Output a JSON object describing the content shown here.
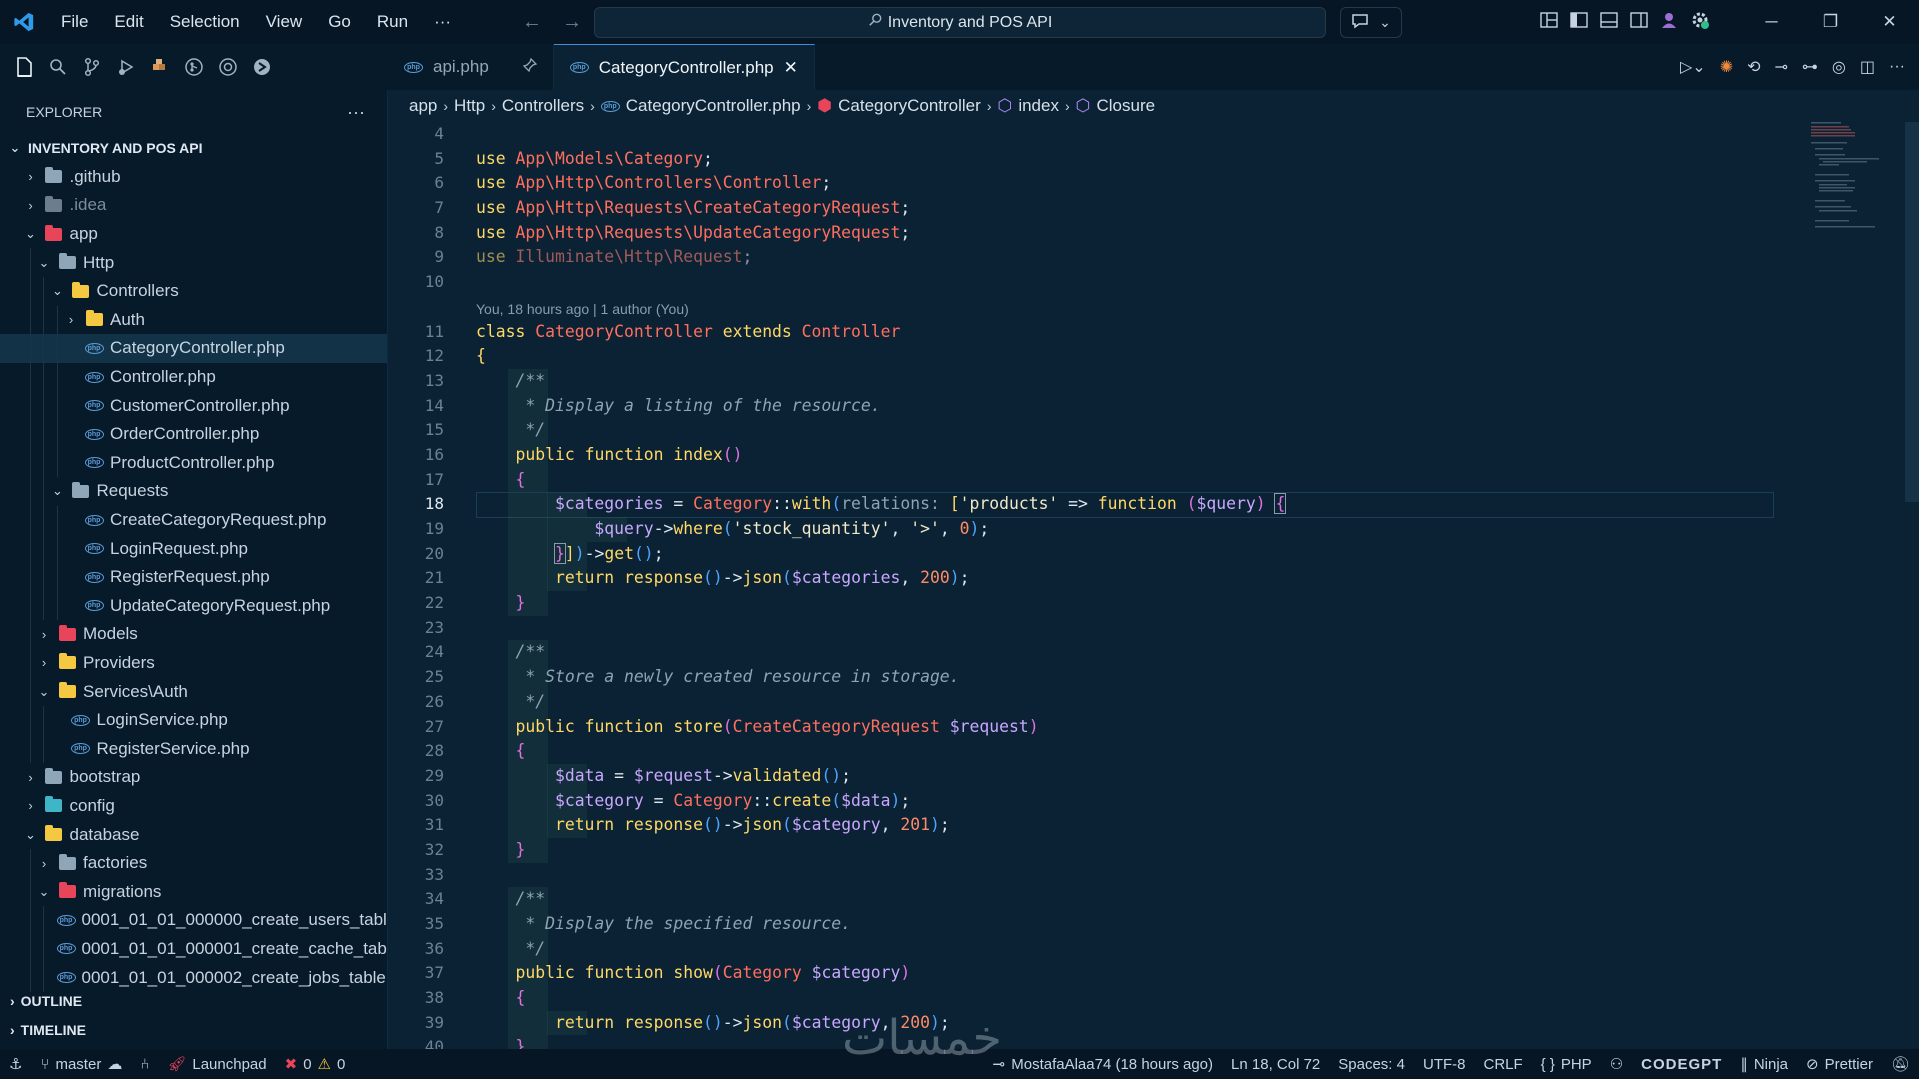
{
  "window": {
    "title": "Inventory and POS API"
  },
  "menu": [
    "File",
    "Edit",
    "Selection",
    "View",
    "Go",
    "Run",
    "···"
  ],
  "sidebar": {
    "header": "EXPLORER",
    "more": "···",
    "project": "INVENTORY AND POS API",
    "items": [
      {
        "label": ".github",
        "depth": 1,
        "kind": "folder",
        "color": "#8fa6b8",
        "open": false,
        "chev": true
      },
      {
        "label": ".idea",
        "depth": 1,
        "kind": "folder",
        "color": "#6c7e8c",
        "open": false,
        "chev": true,
        "dim": true
      },
      {
        "label": "app",
        "depth": 1,
        "kind": "folder",
        "color": "#e8455a",
        "open": true,
        "chev": true
      },
      {
        "label": "Http",
        "depth": 2,
        "kind": "folder",
        "color": "#8fa6b8",
        "open": true,
        "chev": true
      },
      {
        "label": "Controllers",
        "depth": 3,
        "kind": "folder",
        "color": "#f5c842",
        "open": true,
        "chev": true
      },
      {
        "label": "Auth",
        "depth": 4,
        "kind": "folder",
        "color": "#f5c842",
        "open": false,
        "chev": true
      },
      {
        "label": "CategoryController.php",
        "depth": 4,
        "kind": "php",
        "selected": true
      },
      {
        "label": "Controller.php",
        "depth": 4,
        "kind": "php"
      },
      {
        "label": "CustomerController.php",
        "depth": 4,
        "kind": "php"
      },
      {
        "label": "OrderController.php",
        "depth": 4,
        "kind": "php"
      },
      {
        "label": "ProductController.php",
        "depth": 4,
        "kind": "php"
      },
      {
        "label": "Requests",
        "depth": 3,
        "kind": "folder",
        "color": "#8fa6b8",
        "open": true,
        "chev": true
      },
      {
        "label": "CreateCategoryRequest.php",
        "depth": 4,
        "kind": "php"
      },
      {
        "label": "LoginRequest.php",
        "depth": 4,
        "kind": "php"
      },
      {
        "label": "RegisterRequest.php",
        "depth": 4,
        "kind": "php"
      },
      {
        "label": "UpdateCategoryRequest.php",
        "depth": 4,
        "kind": "php"
      },
      {
        "label": "Models",
        "depth": 2,
        "kind": "folder",
        "color": "#e8455a",
        "open": false,
        "chev": true
      },
      {
        "label": "Providers",
        "depth": 2,
        "kind": "folder",
        "color": "#f5c842",
        "open": false,
        "chev": true
      },
      {
        "label": "Services\\Auth",
        "depth": 2,
        "kind": "folder",
        "color": "#f5c842",
        "open": true,
        "chev": true
      },
      {
        "label": "LoginService.php",
        "depth": 3,
        "kind": "php"
      },
      {
        "label": "RegisterService.php",
        "depth": 3,
        "kind": "php"
      },
      {
        "label": "bootstrap",
        "depth": 1,
        "kind": "folder",
        "color": "#8fa6b8",
        "open": false,
        "chev": true
      },
      {
        "label": "config",
        "depth": 1,
        "kind": "folder",
        "color": "#3fb6c8",
        "open": false,
        "chev": true
      },
      {
        "label": "database",
        "depth": 1,
        "kind": "folder",
        "color": "#f5c842",
        "open": true,
        "chev": true
      },
      {
        "label": "factories",
        "depth": 2,
        "kind": "folder",
        "color": "#8fa6b8",
        "open": false,
        "chev": true
      },
      {
        "label": "migrations",
        "depth": 2,
        "kind": "folder",
        "color": "#e8455a",
        "open": true,
        "chev": true
      },
      {
        "label": "0001_01_01_000000_create_users_tabl...",
        "depth": 3,
        "kind": "php"
      },
      {
        "label": "0001_01_01_000001_create_cache_tabl...",
        "depth": 3,
        "kind": "php"
      },
      {
        "label": "0001_01_01_000002_create_jobs_table...",
        "depth": 3,
        "kind": "php"
      }
    ],
    "outline": "OUTLINE",
    "timeline": "TIMELINE"
  },
  "tabs": [
    {
      "label": "api.php",
      "active": false
    },
    {
      "label": "CategoryController.php",
      "active": true
    }
  ],
  "breadcrumb": [
    "app",
    "Http",
    "Controllers",
    "CategoryController.php",
    "CategoryController",
    "index",
    "Closure"
  ],
  "editor": {
    "lens": "You, 18 hours ago | 1 author (You)",
    "lines": [
      {
        "n": "4",
        "html": ""
      },
      {
        "n": "5",
        "html": "<span class=\"k\">use</span> <span class=\"ns\">App\\Models\\Category</span>;"
      },
      {
        "n": "6",
        "html": "<span class=\"k\">use</span> <span class=\"ns\">App\\Http\\Controllers\\Controller</span>;"
      },
      {
        "n": "7",
        "html": "<span class=\"k\">use</span> <span class=\"ns\">App\\Http\\Requests\\CreateCategoryRequest</span>;"
      },
      {
        "n": "8",
        "html": "<span class=\"k\">use</span> <span class=\"ns\">App\\Http\\Requests\\UpdateCategoryRequest</span>;"
      },
      {
        "n": "9",
        "html": "<span class=\"k\" style=\"opacity:.6\">use</span> <span class=\"dim\">Illuminate\\Http\\Request</span><span style=\"opacity:.6\">;</span>"
      },
      {
        "n": "10",
        "html": ""
      },
      {
        "lens": true
      },
      {
        "n": "11",
        "html": "<span class=\"k\">class</span> <span class=\"cls\">CategoryController</span> <span class=\"k\">extends</span> <span class=\"cls\">Controller</span>"
      },
      {
        "n": "12",
        "html": "<span class=\"br1\">{</span>"
      },
      {
        "n": "13",
        "guides": 1,
        "html": "    <span class=\"cm\">/**</span>"
      },
      {
        "n": "14",
        "guides": 1,
        "html": "    <span class=\"cm\"> * Display a listing of the resource.</span>"
      },
      {
        "n": "15",
        "guides": 1,
        "html": "    <span class=\"cm\"> */</span>"
      },
      {
        "n": "16",
        "guides": 1,
        "html": "    <span class=\"k\">public</span> <span class=\"k\">function</span> <span class=\"fn\">index</span><span class=\"br2\">()</span>"
      },
      {
        "n": "17",
        "guides": 1,
        "html": "    <span class=\"br2\">{</span>"
      },
      {
        "n": "18",
        "guides": 2,
        "active": true,
        "html": "        <span class=\"var\">$categories</span> = <span class=\"cls\">Category</span>::<span class=\"fn\">with</span><span class=\"br3\">(</span><span class=\"hint\">relations:</span> <span class=\"br1\">[</span><span class=\"str\">'products'</span> => <span class=\"k\">function</span> <span class=\"br2\">(</span><span class=\"var\">$query</span><span class=\"br2\">)</span> <span class=\"br2\" style=\"outline:1px solid #8a9caa\">{</span>"
      },
      {
        "n": "19",
        "guides": 3,
        "html": "            <span class=\"var\">$query</span>-><span class=\"fn\">where</span><span class=\"br3\">(</span><span class=\"str\">'stock_quantity'</span>, <span class=\"str\">'>'</span>, <span class=\"num\">0</span><span class=\"br3\">)</span>;"
      },
      {
        "n": "20",
        "guides": 2,
        "html": "        <span class=\"br2\" style=\"outline:1px solid #8a9caa\">}</span><span class=\"br1\">]</span><span class=\"br3\">)</span>-><span class=\"fn\">get</span><span class=\"br3\">()</span>;"
      },
      {
        "n": "21",
        "guides": 2,
        "html": "        <span class=\"k\">return</span> <span class=\"fn\">response</span><span class=\"br3\">()</span>-><span class=\"fn\">json</span><span class=\"br3\">(</span><span class=\"var\">$categories</span>, <span class=\"num\">200</span><span class=\"br3\">)</span>;"
      },
      {
        "n": "22",
        "guides": 1,
        "html": "    <span class=\"br2\">}</span>"
      },
      {
        "n": "23",
        "html": ""
      },
      {
        "n": "24",
        "guides": 1,
        "html": "    <span class=\"cm\">/**</span>"
      },
      {
        "n": "25",
        "guides": 1,
        "html": "    <span class=\"cm\"> * Store a newly created resource in storage.</span>"
      },
      {
        "n": "26",
        "guides": 1,
        "html": "    <span class=\"cm\"> */</span>"
      },
      {
        "n": "27",
        "guides": 1,
        "html": "    <span class=\"k\">public</span> <span class=\"k\">function</span> <span class=\"fn\">store</span><span class=\"br2\">(</span><span class=\"cls\">CreateCategoryRequest</span> <span class=\"var\">$request</span><span class=\"br2\">)</span>"
      },
      {
        "n": "28",
        "guides": 1,
        "html": "    <span class=\"br2\">{</span>"
      },
      {
        "n": "29",
        "guides": 2,
        "html": "        <span class=\"var\">$data</span> = <span class=\"var\">$request</span>-><span class=\"fn\">validated</span><span class=\"br3\">()</span>;"
      },
      {
        "n": "30",
        "guides": 2,
        "html": "        <span class=\"var\">$category</span> = <span class=\"cls\">Category</span>::<span class=\"fn\">create</span><span class=\"br3\">(</span><span class=\"var\">$data</span><span class=\"br3\">)</span>;"
      },
      {
        "n": "31",
        "guides": 2,
        "html": "        <span class=\"k\">return</span> <span class=\"fn\">response</span><span class=\"br3\">()</span>-><span class=\"fn\">json</span><span class=\"br3\">(</span><span class=\"var\">$category</span>, <span class=\"num\">201</span><span class=\"br3\">)</span>;"
      },
      {
        "n": "32",
        "guides": 1,
        "html": "    <span class=\"br2\">}</span>"
      },
      {
        "n": "33",
        "html": ""
      },
      {
        "n": "34",
        "guides": 1,
        "html": "    <span class=\"cm\">/**</span>"
      },
      {
        "n": "35",
        "guides": 1,
        "html": "    <span class=\"cm\"> * Display the specified resource.</span>"
      },
      {
        "n": "36",
        "guides": 1,
        "html": "    <span class=\"cm\"> */</span>"
      },
      {
        "n": "37",
        "guides": 1,
        "html": "    <span class=\"k\">public</span> <span class=\"k\">function</span> <span class=\"fn\">show</span><span class=\"br2\">(</span><span class=\"cls\">Category</span> <span class=\"var\">$category</span><span class=\"br2\">)</span>"
      },
      {
        "n": "38",
        "guides": 1,
        "html": "    <span class=\"br2\">{</span>"
      },
      {
        "n": "39",
        "guides": 2,
        "html": "        <span class=\"k\">return</span> <span class=\"fn\">response</span><span class=\"br3\">()</span>-><span class=\"fn\">json</span><span class=\"br3\">(</span><span class=\"var\">$category</span>, <span class=\"num\">200</span><span class=\"br3\">)</span>;"
      },
      {
        "n": "40",
        "guides": 1,
        "html": "    <span class=\"br2\">}</span>"
      }
    ]
  },
  "status": {
    "branch": "master",
    "launchpad": "Launchpad",
    "errors": "0",
    "warnings": "0",
    "blame": "MostafaAlaa74 (18 hours ago)",
    "position": "Ln 18, Col 72",
    "spaces": "Spaces: 4",
    "encoding": "UTF-8",
    "eol": "CRLF",
    "language": "PHP",
    "codegpt": "CODEGPT",
    "ninja": "Ninja",
    "prettier": "Prettier"
  },
  "watermark": "خمسات"
}
